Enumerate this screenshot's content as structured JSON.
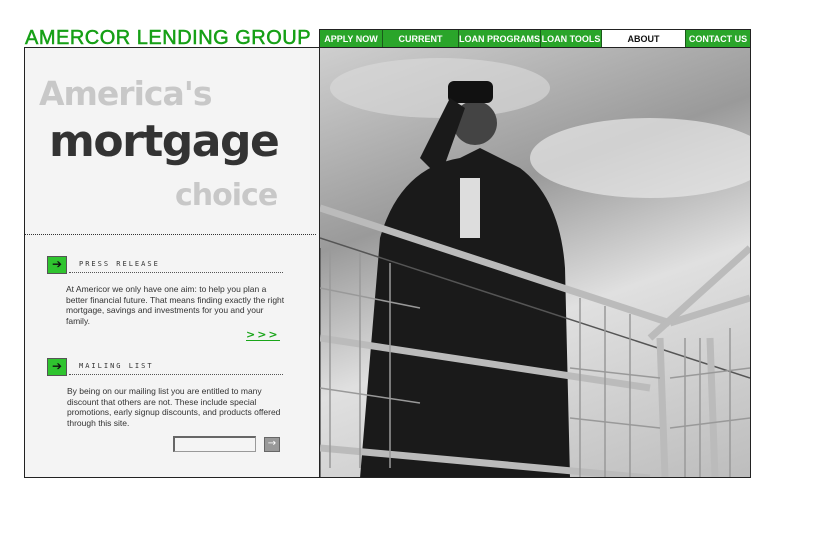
{
  "header": {
    "logo": "AMERCOR LENDING GROUP"
  },
  "nav": {
    "items": [
      {
        "label": "APPLY NOW",
        "active": false
      },
      {
        "label": "CURRENT RATES",
        "active": false
      },
      {
        "label": "LOAN PROGRAMS",
        "active": false
      },
      {
        "label": "LOAN TOOLS",
        "active": false
      },
      {
        "label": "ABOUT AMERICOR",
        "active": true
      },
      {
        "label": "CONTACT US",
        "active": false
      }
    ]
  },
  "tagline": {
    "line1": "America's",
    "line2": "mortgage",
    "line3": "choice"
  },
  "press_release": {
    "title": "PRESS RELEASE",
    "body": "At Americor we only have one aim: to help you plan a better financial future. That means finding exactly the right mortgage, savings and investments for you and your family.",
    "more": ">>>"
  },
  "mailing_list": {
    "title": "MAILING LIST",
    "body": "By being on our mailing list you are entitled to many discount that others are not. These include special promotions, early signup discounts, and products offered through this site.",
    "email_value": "",
    "go_icon": "arrow-right-icon"
  },
  "colors": {
    "brand_green": "#16a016",
    "nav_green": "#2aa52a"
  }
}
